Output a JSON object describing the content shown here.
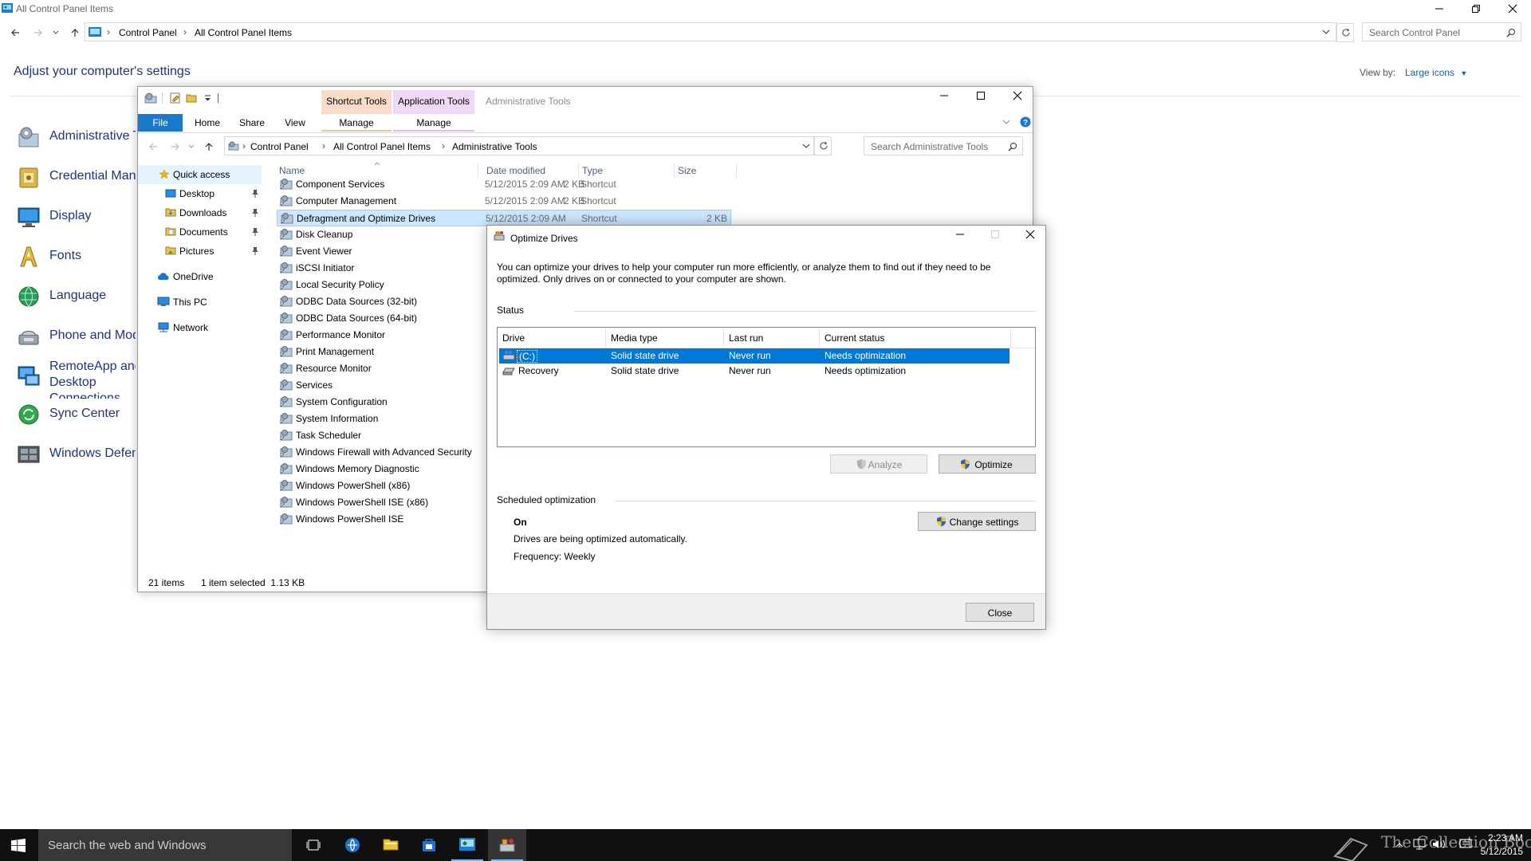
{
  "control_panel": {
    "title": "All Control Panel Items",
    "breadcrumb": [
      "Control Panel",
      "All Control Panel Items"
    ],
    "search_placeholder": "Search Control Panel",
    "heading": "Adjust your computer's settings",
    "view_by_label": "View by:",
    "view_by_value": "Large icons",
    "items": [
      {
        "label": "Administrative Tools",
        "icon": "admin-tools-icon"
      },
      {
        "label": "Credential Manager",
        "icon": "credential-manager-icon"
      },
      {
        "label": "Display",
        "icon": "display-icon"
      },
      {
        "label": "Fonts",
        "icon": "fonts-icon"
      },
      {
        "label": "Language",
        "icon": "language-icon"
      },
      {
        "label": "Phone and Modem",
        "icon": "phone-modem-icon"
      },
      {
        "label": "RemoteApp and Desktop Connections",
        "icon": "remoteapp-icon"
      },
      {
        "label": "Sync Center",
        "icon": "sync-center-icon"
      },
      {
        "label": "Windows Defender",
        "icon": "windows-defender-icon"
      }
    ]
  },
  "explorer": {
    "title": "Administrative Tools",
    "context_tabs": [
      {
        "header": "Shortcut Tools",
        "tab": "Manage",
        "color": "#f8c8a8"
      },
      {
        "header": "Application Tools",
        "tab": "Manage",
        "color": "#e8c8f0"
      }
    ],
    "ribbon_tabs": [
      "File",
      "Home",
      "Share",
      "View"
    ],
    "breadcrumb": [
      "Control Panel",
      "All Control Panel Items",
      "Administrative Tools"
    ],
    "search_placeholder": "Search Administrative Tools",
    "nav_pane": [
      {
        "label": "Quick access",
        "icon": "star-icon",
        "pinned": false
      },
      {
        "label": "Desktop",
        "icon": "folder-icon",
        "pinned": true
      },
      {
        "label": "Downloads",
        "icon": "downloads-folder-icon",
        "pinned": true
      },
      {
        "label": "Documents",
        "icon": "folder-icon",
        "pinned": true
      },
      {
        "label": "Pictures",
        "icon": "folder-icon",
        "pinned": true
      },
      {
        "label": "OneDrive",
        "icon": "onedrive-icon",
        "pinned": false
      },
      {
        "label": "This PC",
        "icon": "this-pc-icon",
        "pinned": false
      },
      {
        "label": "Network",
        "icon": "network-icon",
        "pinned": false
      }
    ],
    "columns": [
      "Name",
      "Date modified",
      "Type",
      "Size"
    ],
    "files": [
      {
        "name": "Component Services",
        "date": "5/12/2015 2:09 AM",
        "type": "Shortcut",
        "size": "2 KB"
      },
      {
        "name": "Computer Management",
        "date": "5/12/2015 2:09 AM",
        "type": "Shortcut",
        "size": "2 KB"
      },
      {
        "name": "Defragment and Optimize Drives",
        "date": "5/12/2015 2:09 AM",
        "type": "Shortcut",
        "size": "2 KB",
        "selected": true
      },
      {
        "name": "Disk Cleanup"
      },
      {
        "name": "Event Viewer"
      },
      {
        "name": "iSCSI Initiator"
      },
      {
        "name": "Local Security Policy"
      },
      {
        "name": "ODBC Data Sources (32-bit)"
      },
      {
        "name": "ODBC Data Sources (64-bit)"
      },
      {
        "name": "Performance Monitor"
      },
      {
        "name": "Print Management"
      },
      {
        "name": "Resource Monitor"
      },
      {
        "name": "Services"
      },
      {
        "name": "System Configuration"
      },
      {
        "name": "System Information"
      },
      {
        "name": "Task Scheduler"
      },
      {
        "name": "Windows Firewall with Advanced Security"
      },
      {
        "name": "Windows Memory Diagnostic"
      },
      {
        "name": "Windows PowerShell (x86)"
      },
      {
        "name": "Windows PowerShell ISE (x86)"
      },
      {
        "name": "Windows PowerShell ISE"
      }
    ],
    "status": {
      "items": "21 items",
      "selected": "1 item selected  1.13 KB"
    }
  },
  "optimize_dialog": {
    "title": "Optimize Drives",
    "description": "You can optimize your drives to help your computer run more efficiently, or analyze them to find out if they need to be optimized. Only drives on or connected to your computer are shown.",
    "status_label": "Status",
    "columns": [
      "Drive",
      "Media type",
      "Last run",
      "Current status"
    ],
    "drives": [
      {
        "drive": "(C:)",
        "media": "Solid state drive",
        "last_run": "Never run",
        "status": "Needs optimization",
        "selected": true
      },
      {
        "drive": "Recovery",
        "media": "Solid state drive",
        "last_run": "Never run",
        "status": "Needs optimization",
        "selected": false
      }
    ],
    "analyze_label": "Analyze",
    "optimize_label": "Optimize",
    "scheduled_label": "Scheduled optimization",
    "schedule_state": "On",
    "schedule_desc": "Drives are being optimized automatically.",
    "frequency": "Frequency: Weekly",
    "change_settings_label": "Change settings",
    "close_label": "Close"
  },
  "taskbar": {
    "search_placeholder": "Search the web and Windows",
    "time": "2:23 AM",
    "date": "5/12/2015",
    "watermark": "The Collection Book"
  },
  "colors": {
    "accent": "#0078d7",
    "file_tab": "#1979ca",
    "link": "#1e3287",
    "selection": "#cce8ff",
    "taskbar": "#101010"
  }
}
